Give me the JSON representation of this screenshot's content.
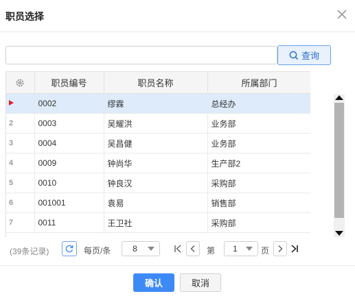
{
  "dialog": {
    "title": "职员选择"
  },
  "search": {
    "value": "",
    "placeholder": "",
    "button_label": "查询"
  },
  "grid": {
    "columns": [
      "职员编号",
      "职员名称",
      "所属部门"
    ],
    "rows": [
      {
        "row_no": "",
        "code": "0002",
        "name": "缪霖",
        "dept": "总经办",
        "selected": true
      },
      {
        "row_no": "2",
        "code": "0003",
        "name": "吴耀洪",
        "dept": "业务部"
      },
      {
        "row_no": "3",
        "code": "0004",
        "name": "吴昌健",
        "dept": "业务部"
      },
      {
        "row_no": "4",
        "code": "0009",
        "name": "钟尚华",
        "dept": "生产部2"
      },
      {
        "row_no": "5",
        "code": "0010",
        "name": "钟良汉",
        "dept": "采购部"
      },
      {
        "row_no": "6",
        "code": "001001",
        "name": "袁易",
        "dept": "销售部"
      },
      {
        "row_no": "7",
        "code": "0011",
        "name": "王卫社",
        "dept": "采购部"
      }
    ]
  },
  "pager": {
    "records": "(39条记录)",
    "per_page_label": "每页/条",
    "page_size": "8",
    "page_prefix": "第",
    "page_number": "1",
    "page_suffix": "页"
  },
  "footer": {
    "confirm_label": "确认",
    "cancel_label": "取消"
  },
  "colors": {
    "accent": "#3d8af7",
    "selected_row": "#ddebfb",
    "marker": "#e02020"
  },
  "icons": [
    "close-icon",
    "search-icon",
    "gear-icon",
    "current-row-icon",
    "refresh-icon",
    "first-page-icon",
    "prev-page-icon",
    "next-page-icon",
    "last-page-icon",
    "chevron-down-icon"
  ]
}
